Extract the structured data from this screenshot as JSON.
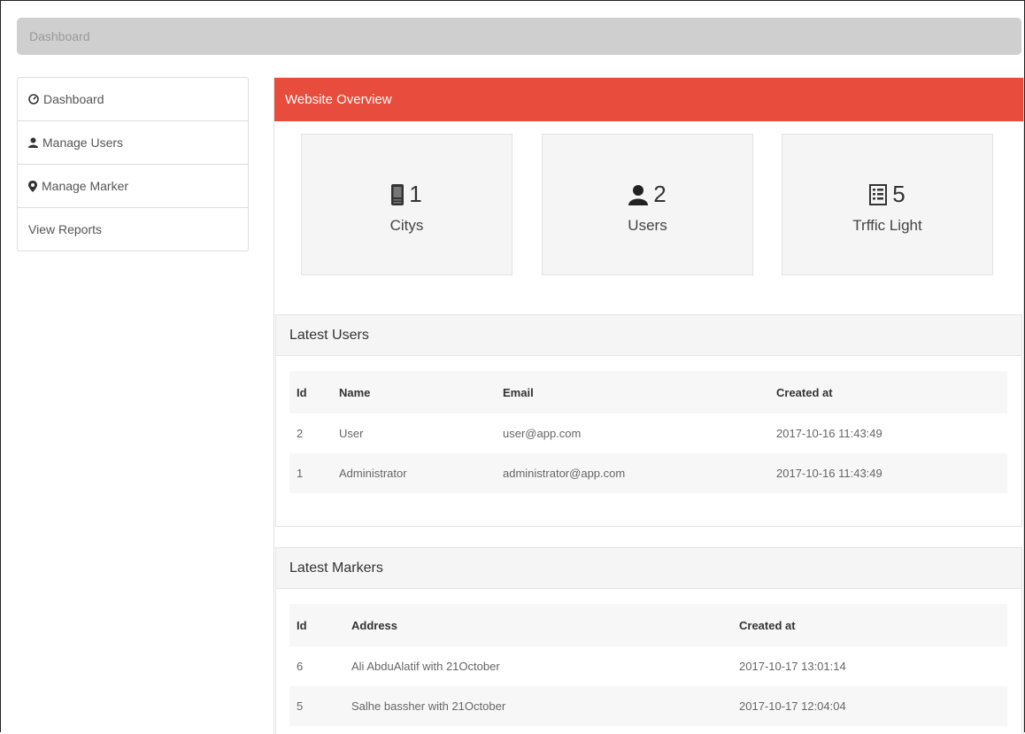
{
  "breadcrumb": "Dashboard",
  "sidebar": {
    "items": [
      {
        "label": "Dashboard",
        "icon": "dashboard-icon"
      },
      {
        "label": "Manage Users",
        "icon": "user-icon"
      },
      {
        "label": "Manage Marker",
        "icon": "map-marker-icon"
      },
      {
        "label": "View Reports",
        "icon": ""
      }
    ]
  },
  "overview": {
    "title": "Website Overview",
    "accent": "#e74c3c",
    "stats": [
      {
        "value": "1",
        "label": "Citys",
        "icon": "phone-icon"
      },
      {
        "value": "2",
        "label": "Users",
        "icon": "user-icon"
      },
      {
        "value": "5",
        "label": "Trffic Light",
        "icon": "list-icon"
      }
    ]
  },
  "latest_users": {
    "title": "Latest Users",
    "columns": [
      "Id",
      "Name",
      "Email",
      "Created at"
    ],
    "rows": [
      [
        "2",
        "User",
        "user@app.com",
        "2017-10-16 11:43:49"
      ],
      [
        "1",
        "Administrator",
        "administrator@app.com",
        "2017-10-16 11:43:49"
      ]
    ]
  },
  "latest_markers": {
    "title": "Latest Markers",
    "columns": [
      "Id",
      "Address",
      "Created at"
    ],
    "rows": [
      [
        "6",
        "Ali AbduAlatif with 21October",
        "2017-10-17 13:01:14"
      ],
      [
        "5",
        "Salhe bassher with 21October",
        "2017-10-17 12:04:04"
      ]
    ]
  }
}
